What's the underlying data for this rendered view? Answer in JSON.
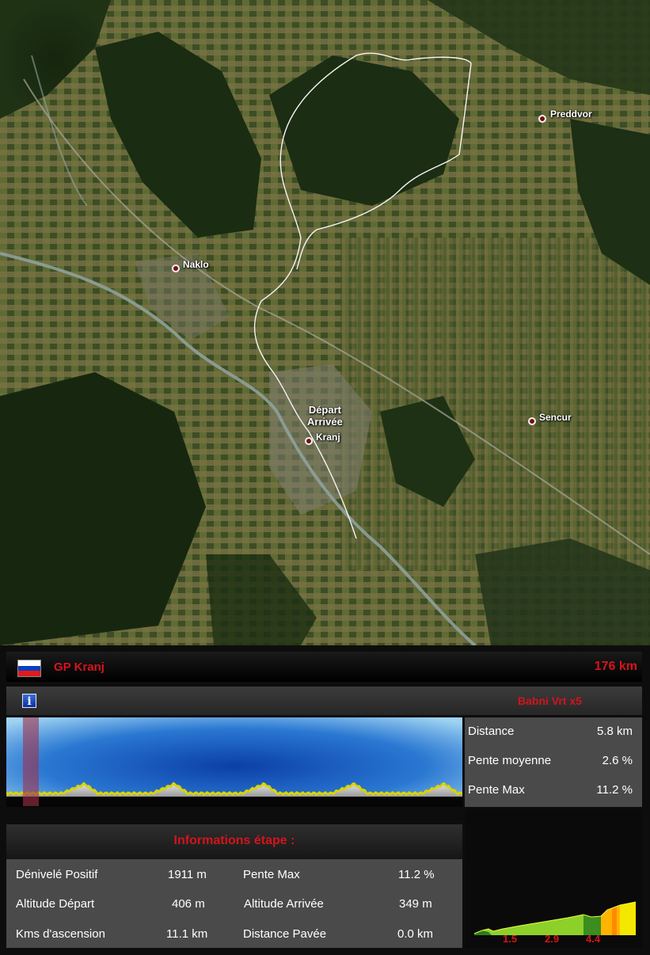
{
  "map": {
    "places": [
      {
        "name": "Preddvor"
      },
      {
        "name": "Naklo"
      },
      {
        "name": "Sencur"
      },
      {
        "name": "Kranj"
      }
    ],
    "start_label_line1": "Départ",
    "start_label_line2": "Arrivée"
  },
  "race": {
    "name": "GP Kranj",
    "distance": "176 km",
    "flag_colors": [
      "#ffffff",
      "#0b3fbf",
      "#e01a1a"
    ]
  },
  "climb": {
    "name": "Babni Vrt x5",
    "stats": [
      {
        "label": "Distance",
        "value": "5.8 km"
      },
      {
        "label": "Pente moyenne",
        "value": "2.6 %"
      },
      {
        "label": "Pente Max",
        "value": "11.2 %"
      }
    ],
    "km_ticks": [
      "1.5",
      "2.9",
      "4.4"
    ]
  },
  "stage": {
    "title": "Informations étape :",
    "stats": [
      {
        "label": "Dénivelé Positif",
        "value": "1911 m"
      },
      {
        "label": "Pente Max",
        "value": "11.2 %"
      },
      {
        "label": "Altitude Départ",
        "value": "406 m"
      },
      {
        "label": "Altitude Arrivée",
        "value": "349 m"
      },
      {
        "label": "Kms d'ascension",
        "value": "11.1 km"
      },
      {
        "label": "Distance Pavée",
        "value": "0.0 km"
      }
    ]
  }
}
